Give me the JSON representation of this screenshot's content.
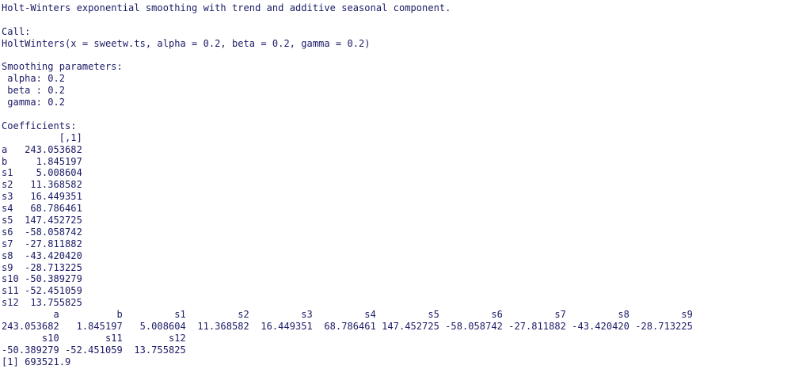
{
  "console": {
    "header": "Holt-Winters exponential smoothing with trend and additive seasonal component.",
    "call_label": "Call:",
    "call": "HoltWinters(x = sweetw.ts, alpha = 0.2, beta = 0.2, gamma = 0.2)",
    "smoothing_label": "Smoothing parameters:",
    "params": [
      " alpha: 0.2",
      " beta : 0.2",
      " gamma: 0.2"
    ],
    "coefficients_label": "Coefficients:",
    "coef_table": [
      "          [,1]",
      "a   243.053682",
      "b     1.845197",
      "s1    5.008604",
      "s2   11.368582",
      "s3   16.449351",
      "s4   68.786461",
      "s5  147.452725",
      "s6  -58.058742",
      "s7  -27.811882",
      "s8  -43.420420",
      "s9  -28.713225",
      "s10 -50.389279",
      "s11 -52.451059",
      "s12  13.755825"
    ],
    "coef_vector": [
      "         a          b         s1         s2         s3         s4         s5         s6         s7         s8         s9",
      "243.053682   1.845197   5.008604  11.368582  16.449351  68.786461 147.452725 -58.058742 -27.811882 -43.420420 -28.713225",
      "       s10        s11        s12",
      "-50.389279 -52.451059  13.755825"
    ],
    "sse": "[1] 693521.9"
  }
}
